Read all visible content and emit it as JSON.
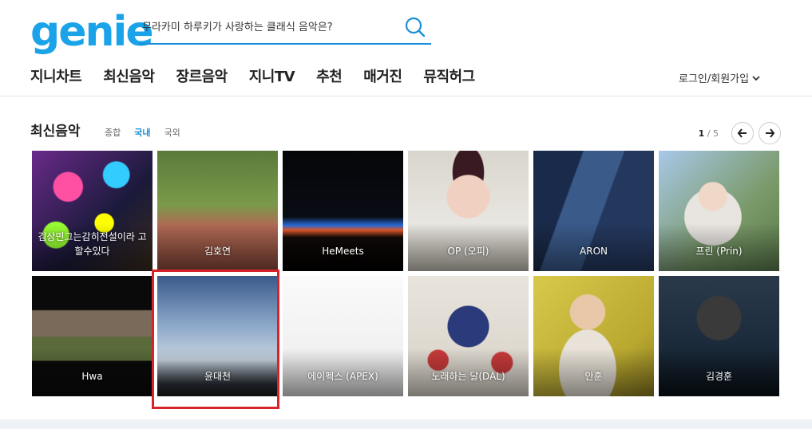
{
  "header": {
    "logo": "genie",
    "search": {
      "value": "무라카미 하루키가 사랑하는 클래식 음악은?"
    },
    "nav": [
      "지니차트",
      "최신음악",
      "장르음악",
      "지니TV",
      "추천",
      "매거진",
      "뮤직허그"
    ],
    "login": "로그인/회원가입"
  },
  "section": {
    "title": "최신음악",
    "tabs": [
      "종합",
      "국내",
      "국외"
    ],
    "active_tab": "국내",
    "page_current": "1",
    "page_sep": "/",
    "page_total": "5"
  },
  "albums": [
    {
      "name": "김상민그는감히전설이라 고할수있다"
    },
    {
      "name": "김호연"
    },
    {
      "name": "HeMeets"
    },
    {
      "name": "OP (오피)"
    },
    {
      "name": "ARON"
    },
    {
      "name": "프린 (Prin)"
    },
    {
      "name": "Hwa"
    },
    {
      "name": "윤대천"
    },
    {
      "name": "에이펙스 (APEX)"
    },
    {
      "name": "노래하는 달(DAL)"
    },
    {
      "name": "안훈"
    },
    {
      "name": "김경훈"
    }
  ],
  "colors": {
    "brand": "#1aa3e8",
    "accent": "#1a8fd8",
    "highlight": "#d8232a"
  }
}
